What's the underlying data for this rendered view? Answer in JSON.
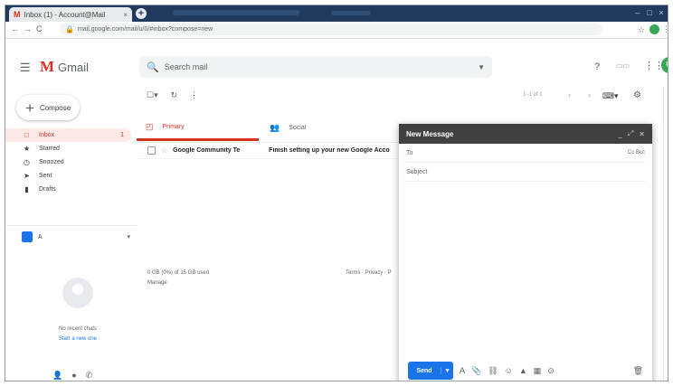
{
  "browser": {
    "tab_title": "Inbox (1) - Account@Mail",
    "tab_close": "×",
    "new_tab": "+",
    "url": "mail.google.com/mail/u/0/#inbox?compose=new",
    "window_buttons": [
      "–",
      "□",
      "×"
    ],
    "nav": [
      "←",
      "→",
      "C"
    ]
  },
  "header": {
    "logo_text": "Gmail",
    "search_placeholder": "Search mail",
    "avatar_letter": "G"
  },
  "sidebar": {
    "compose_label": "Compose",
    "items": [
      {
        "icon": "□",
        "label": "Inbox",
        "count": "1",
        "active": true
      },
      {
        "icon": "★",
        "label": "Starred",
        "count": ""
      },
      {
        "icon": "◷",
        "label": "Snoozed",
        "count": ""
      },
      {
        "icon": "➤",
        "label": "Sent",
        "count": ""
      },
      {
        "icon": "▮",
        "label": "Drafts",
        "count": ""
      }
    ],
    "hangouts_user": "A",
    "hangouts_dropdown": "▾",
    "chat_empty": "No recent chats",
    "chat_start": "Start a new one"
  },
  "main": {
    "pager": "1–1 of 1",
    "tabs": [
      {
        "label": "Primary",
        "icon": "◰"
      },
      {
        "label": "Social",
        "icon": "👥"
      }
    ],
    "rows": [
      {
        "sender": "Google Community Te",
        "subject": "Finish setting up your new Google Acco"
      }
    ],
    "footer_storage": "0 GB (0%) of 15 GB used",
    "footer_manage": "Manage",
    "footer_links": "Terms · Privacy · P"
  },
  "compose": {
    "title": "New Message",
    "to_label": "To",
    "cc_bcc": "Cc Bcc",
    "subject_placeholder": "Subject",
    "send_label": "Send"
  },
  "colors": {
    "gmail_red": "#d93025",
    "send_blue": "#1a73e8",
    "compose_header": "#404040"
  }
}
